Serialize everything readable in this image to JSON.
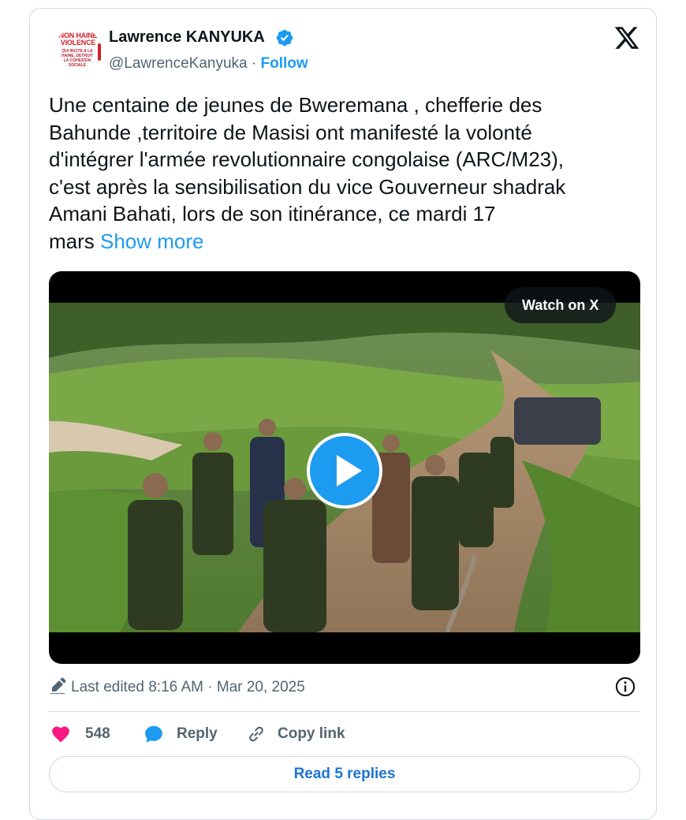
{
  "author": {
    "name": "Lawrence KANYUKA",
    "handle": "@LawrenceKanyuka",
    "separator": " · ",
    "follow_label": "Follow",
    "verified_icon": "verified-badge-icon",
    "avatar_text": {
      "line1": "NON HAINE",
      "line2": "VIOLENCE",
      "line3": "QUI INCITE A LA HAINE, DETRUIT LA COHESION SOCIALE"
    }
  },
  "platform_icon": "x-logo-icon",
  "tweet": {
    "text": "Une centaine de jeunes  de Bweremana  , chefferie des\nBahunde ,territoire de Masisi ont manifesté la volonté\nd'intégrer l'armée revolutionnaire congolaise (ARC/M23),\nc'est après la sensibilisation du vice Gouverneur shadrak\nAmani Bahati, lors de son itinérance, ce mardi 17\nmars ",
    "show_more": "Show more"
  },
  "media": {
    "watch_label": "Watch on X",
    "play_icon": "play-icon"
  },
  "meta": {
    "edited": "Last edited 8:16 AM · Mar 20, 2025",
    "pencil_icon": "pencil-icon",
    "info_icon": "info-icon"
  },
  "actions": {
    "likes": "548",
    "reply_label": "Reply",
    "copy_link_label": "Copy link"
  },
  "read_replies_label": "Read 5 replies",
  "colors": {
    "accent": "#1d9bf0",
    "heart": "#f91880",
    "muted": "#536471",
    "border": "#cfd9de"
  }
}
